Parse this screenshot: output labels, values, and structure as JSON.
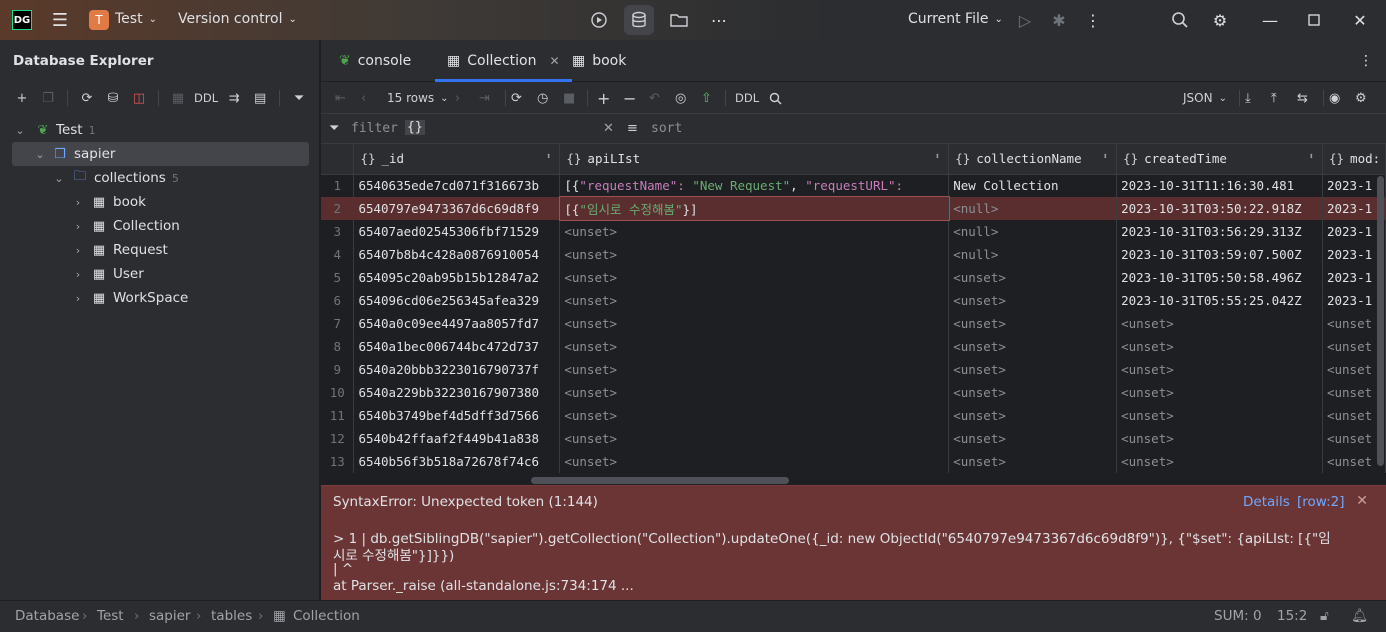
{
  "titlebar": {
    "app_icon_text": "DG",
    "project_badge": "T",
    "project_name": "Test",
    "version_control": "Version control",
    "current_file": "Current File"
  },
  "left_panel": {
    "title": "Database Explorer",
    "toolbar_ddl": "DDL",
    "tree": {
      "root": {
        "label": "Test",
        "count": "1"
      },
      "schema": {
        "label": "sapier"
      },
      "folder": {
        "label": "collections",
        "count": "5"
      },
      "items": [
        "book",
        "Collection",
        "Request",
        "User",
        "WorkSpace"
      ]
    }
  },
  "tabs": [
    {
      "label": "console"
    },
    {
      "label": "Collection"
    },
    {
      "label": "book"
    }
  ],
  "grid_toolbar": {
    "rows_label": "15 rows",
    "ddl_label": "DDL",
    "format_label": "JSON"
  },
  "filter_bar": {
    "filter_label": "filter",
    "filter_value": "{}",
    "sort_label": "sort"
  },
  "table": {
    "columns": [
      "_id",
      "apiLIst",
      "collectionName",
      "createdTime",
      "mod:"
    ],
    "rows": [
      {
        "n": "1",
        "id": "6540635ede7cd071f316673b",
        "api": "[{\"requestName\": \"New Request\", \"requestURL\": \"",
        "name": "New Collection",
        "created": "2023-10-31T11:16:30.481",
        "mod": "2023-1"
      },
      {
        "n": "2",
        "id": "6540797e9473367d6c69d8f9",
        "api": "[{\"임시로 수정해봄\"}]",
        "name": "<null>",
        "created": "2023-10-31T03:50:22.918Z",
        "mod": "2023-1"
      },
      {
        "n": "3",
        "id": "65407aed02545306fbf71529",
        "api": "<unset>",
        "name": "<null>",
        "created": "2023-10-31T03:56:29.313Z",
        "mod": "2023-1"
      },
      {
        "n": "4",
        "id": "65407b8b4c428a0876910054",
        "api": "<unset>",
        "name": "<null>",
        "created": "2023-10-31T03:59:07.500Z",
        "mod": "2023-1"
      },
      {
        "n": "5",
        "id": "654095c20ab95b15b12847a2",
        "api": "<unset>",
        "name": "<unset>",
        "created": "2023-10-31T05:50:58.496Z",
        "mod": "2023-1"
      },
      {
        "n": "6",
        "id": "654096cd06e256345afea329",
        "api": "<unset>",
        "name": "<unset>",
        "created": "2023-10-31T05:55:25.042Z",
        "mod": "2023-1"
      },
      {
        "n": "7",
        "id": "6540a0c09ee4497aa8057fd7",
        "api": "<unset>",
        "name": "<unset>",
        "created": "<unset>",
        "mod": "<unset"
      },
      {
        "n": "8",
        "id": "6540a1bec006744bc472d737",
        "api": "<unset>",
        "name": "<unset>",
        "created": "<unset>",
        "mod": "<unset"
      },
      {
        "n": "9",
        "id": "6540a20bbb3223016790737f",
        "api": "<unset>",
        "name": "<unset>",
        "created": "<unset>",
        "mod": "<unset"
      },
      {
        "n": "10",
        "id": "6540a229bb32230167907380",
        "api": "<unset>",
        "name": "<unset>",
        "created": "<unset>",
        "mod": "<unset"
      },
      {
        "n": "11",
        "id": "6540b3749bef4d5dff3d7566",
        "api": "<unset>",
        "name": "<unset>",
        "created": "<unset>",
        "mod": "<unset"
      },
      {
        "n": "12",
        "id": "6540b42ffaaf2f449b41a838",
        "api": "<unset>",
        "name": "<unset>",
        "created": "<unset>",
        "mod": "<unset"
      },
      {
        "n": "13",
        "id": "6540b56f3b518a72678f74c6",
        "api": "<unset>",
        "name": "<unset>",
        "created": "<unset>",
        "mod": "<unset"
      }
    ]
  },
  "error_panel": {
    "title": "SyntaxError: Unexpected token (1:144)",
    "details_link": "Details",
    "row_link": "[row:2]",
    "line1": "> 1 | db.getSiblingDB(\"sapier\").getCollection(\"Collection\").updateOne({_id: new ObjectId(\"6540797e9473367d6c69d8f9\")}, {\"$set\": {apiLIst: [{\"임",
    "line2": "시로 수정해봄\"}]}})",
    "line3": "| ^",
    "line4": "at Parser._raise (all-standalone.js:734:174 ..."
  },
  "statusbar": {
    "breadcrumbs": [
      "Database",
      "Test",
      "sapier",
      "tables",
      "Collection"
    ],
    "sum": "SUM: 0",
    "position": "15:2"
  },
  "colors": {
    "accent": "#3574f0",
    "error_bg": "#6b3535",
    "error_row": "#5a2e2e",
    "mongo_green": "#4fa34f"
  }
}
